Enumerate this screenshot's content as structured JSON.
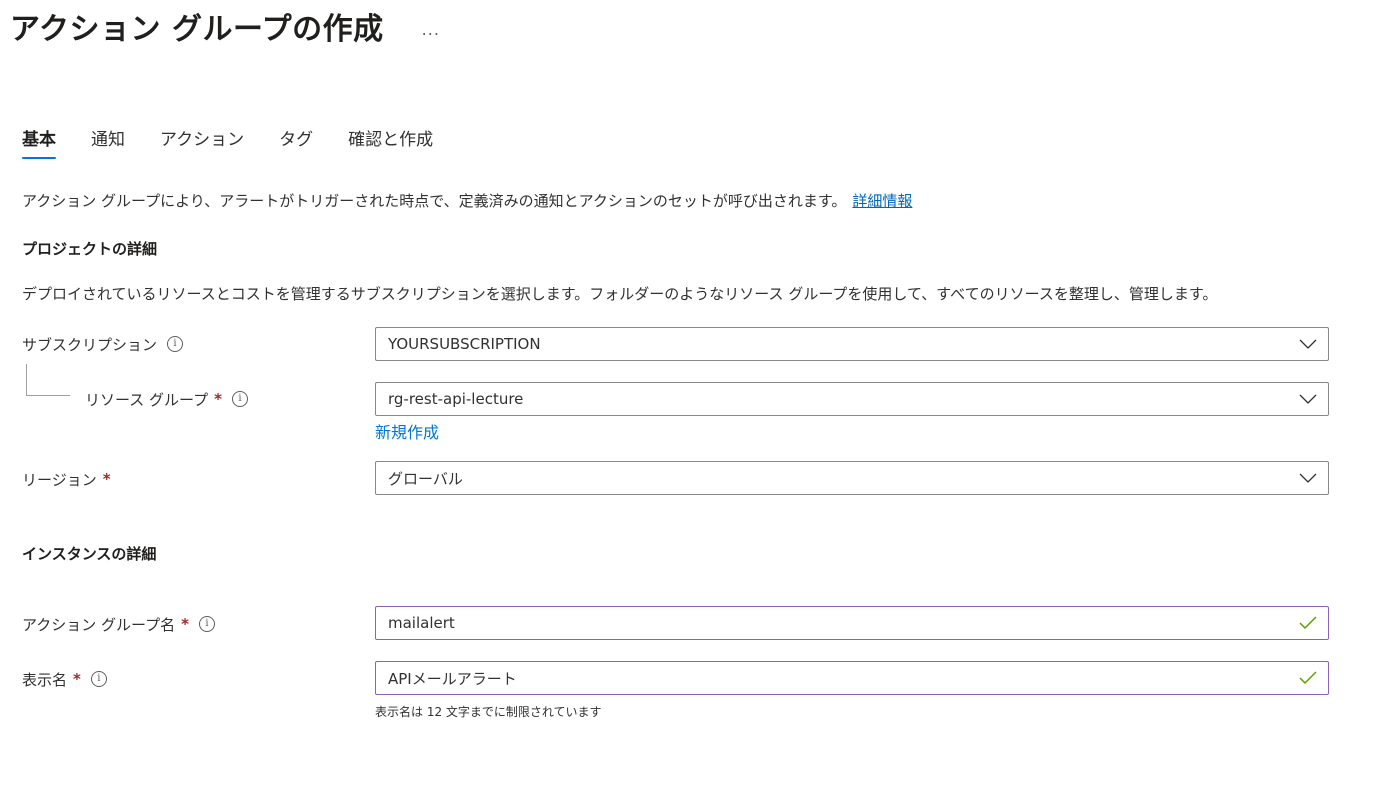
{
  "header": {
    "title": "アクション グループの作成",
    "more_label": "..."
  },
  "tabs": [
    {
      "label": "基本",
      "active": true
    },
    {
      "label": "通知",
      "active": false
    },
    {
      "label": "アクション",
      "active": false
    },
    {
      "label": "タグ",
      "active": false
    },
    {
      "label": "確認と作成",
      "active": false
    }
  ],
  "intro": {
    "text": "アクション グループにより、アラートがトリガーされた時点で、定義済みの通知とアクションのセットが呼び出されます。",
    "link": "詳細情報"
  },
  "project": {
    "heading": "プロジェクトの詳細",
    "description": "デプロイされているリソースとコストを管理するサブスクリプションを選択します。フォルダーのようなリソース グループを使用して、すべてのリソースを整理し、管理します。",
    "subscription_label": "サブスクリプション",
    "subscription_value": "YOURSUBSCRIPTION",
    "rg_label": "リソース グループ",
    "rg_value": "rg-rest-api-lecture",
    "new_link": "新規作成",
    "region_label": "リージョン",
    "region_value": "グローバル"
  },
  "instance": {
    "heading": "インスタンスの詳細",
    "name_label": "アクション グループ名",
    "name_value": "mailalert",
    "display_label": "表示名",
    "display_value": "APIメールアラート",
    "display_hint": "表示名は 12 文字までに制限されています"
  },
  "common": {
    "required_mark": "*",
    "info_glyph": "i"
  },
  "colors": {
    "accent": "#0078d4",
    "link": "#0067b8",
    "required": "#a4262c",
    "valid_border": "#8764b8",
    "check": "#57a300"
  }
}
